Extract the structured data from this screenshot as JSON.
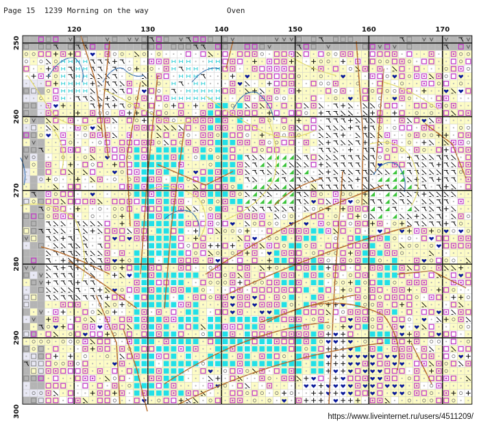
{
  "header": {
    "page_label": "Page 15",
    "pattern_title": "1239 Morning on the way",
    "designer": "Oven"
  },
  "grid": {
    "col_labels": [
      "120",
      "130",
      "140",
      "150",
      "160",
      "170"
    ],
    "row_labels": [
      "250",
      "260",
      "270",
      "280",
      "290",
      "300"
    ]
  },
  "colors": {
    "cyan": "#22e0e8",
    "magenta": "#c23cc6",
    "pale_yellow": "#fdfcc6",
    "gray_fill": "#b4b4b4",
    "navy": "#0a1a9a",
    "green": "#3cc43c",
    "backstitch_brown": "#b56a2a",
    "backstitch_yellow": "#e4dc6a",
    "backstitch_blue": "#3470b0",
    "pale_pink": "#e8b0e4"
  },
  "symbols": [
    "square-outline",
    "square-dot",
    "filled-square",
    "heart",
    "plus",
    "k-mark",
    "slash",
    "h-mark",
    "triangle",
    "circle",
    "dot"
  ],
  "footer": {
    "url": "https://www.liveinternet.ru/users/4511209/"
  }
}
